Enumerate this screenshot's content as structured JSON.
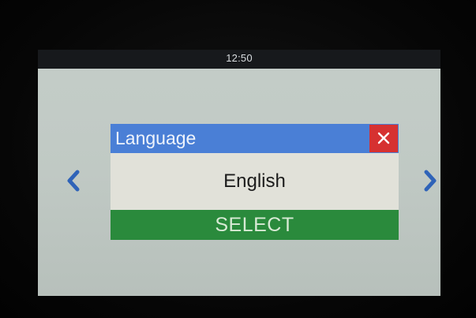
{
  "status_bar": {
    "time": "12:50"
  },
  "navigation": {
    "previous_icon": "chevron-left-icon",
    "next_icon": "chevron-right-icon"
  },
  "dialog": {
    "title": "Language",
    "close_icon": "close-icon",
    "current_value": "English",
    "select_label": "SELECT"
  },
  "colors": {
    "header_blue": "#4a7fd6",
    "close_red": "#d63131",
    "select_green": "#2a8a3c",
    "arrow_blue": "#2f63b8",
    "screen_background": "#c2cbc6"
  }
}
